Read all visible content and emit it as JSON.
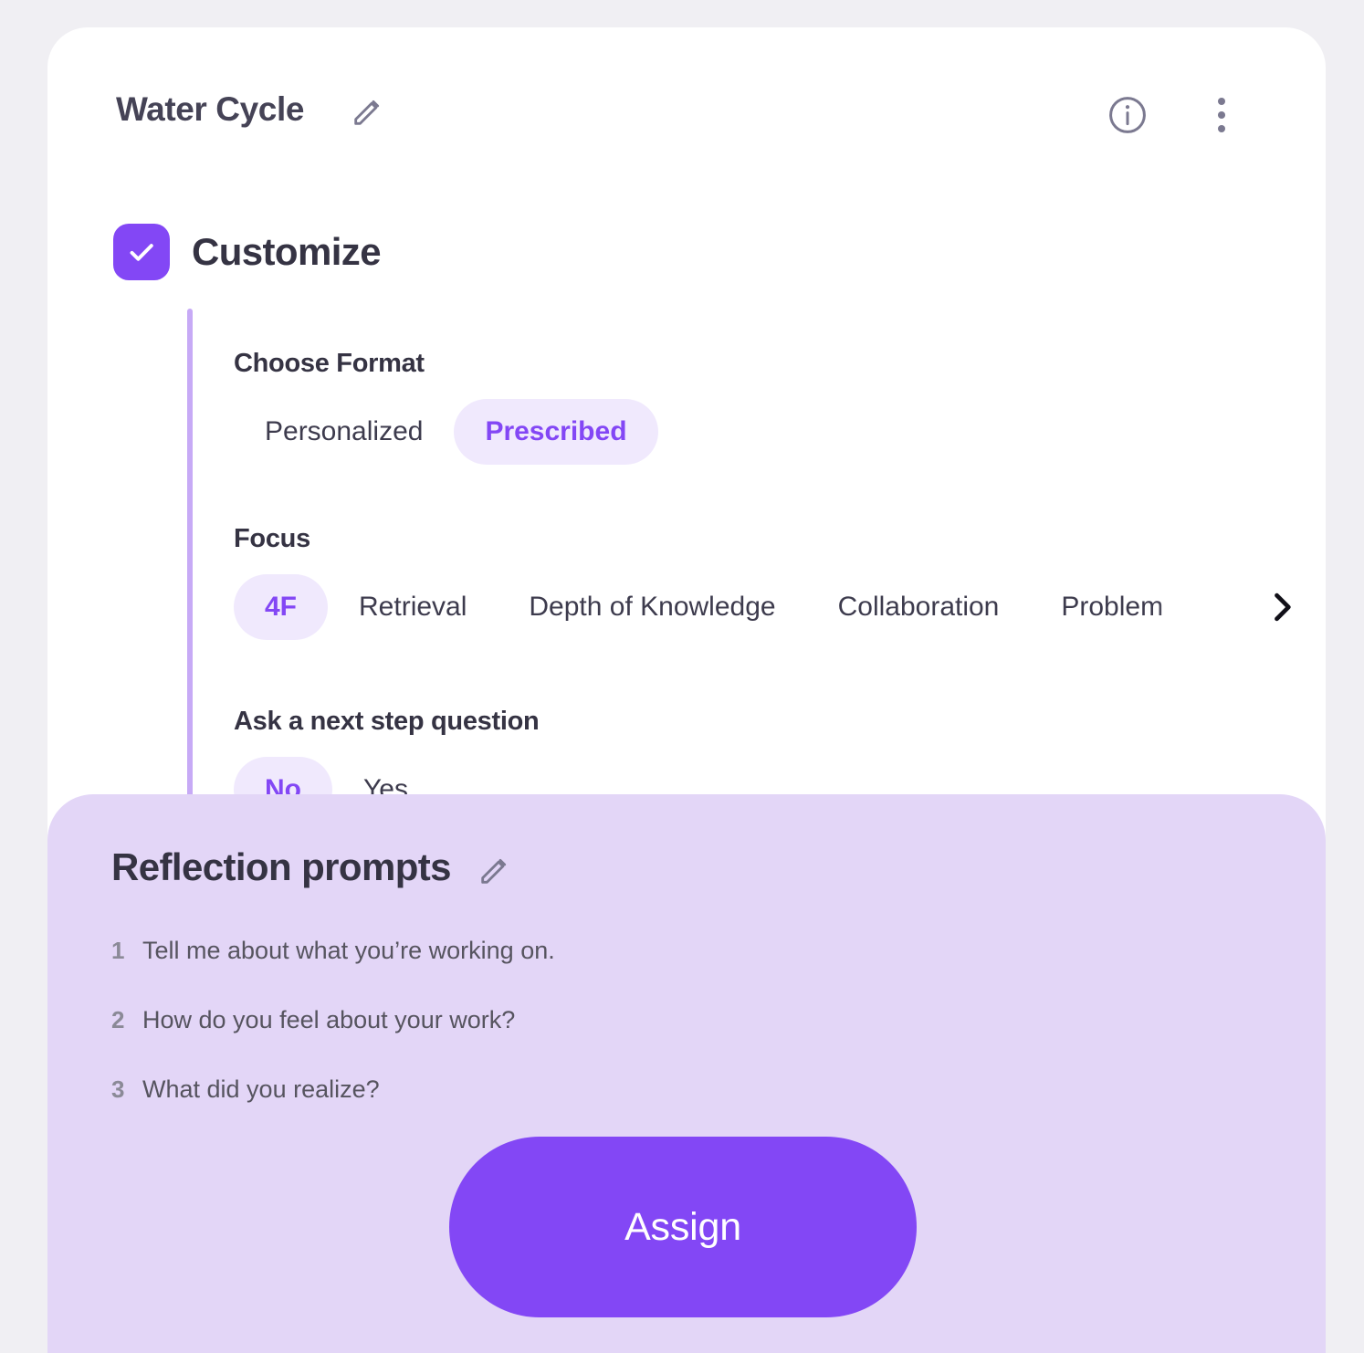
{
  "header": {
    "title": "Water Cycle",
    "edit_icon": "pencil-icon",
    "info_icon": "info-circle-icon",
    "menu_icon": "kebab-menu-icon"
  },
  "customize": {
    "label": "Customize",
    "checked": true,
    "check_icon": "check-icon"
  },
  "groups": [
    {
      "title": "Choose Format",
      "options": [
        {
          "label": "Personalized",
          "selected": false
        },
        {
          "label": "Prescribed",
          "selected": true
        }
      ]
    },
    {
      "title": "Focus",
      "scrollable": true,
      "next_icon": "chevron-right-icon",
      "options": [
        {
          "label": "4F",
          "selected": true
        },
        {
          "label": "Retrieval",
          "selected": false
        },
        {
          "label": "Depth of Knowledge",
          "selected": false
        },
        {
          "label": "Collaboration",
          "selected": false
        },
        {
          "label": "Problem",
          "selected": false
        }
      ]
    },
    {
      "title": "Ask a next step question",
      "options": [
        {
          "label": "No",
          "selected": true
        },
        {
          "label": "Yes",
          "selected": false
        }
      ]
    }
  ],
  "reflection": {
    "title": "Reflection prompts",
    "edit_icon": "pencil-icon",
    "prompts": [
      {
        "num": "1",
        "text": "Tell me about what you’re working on."
      },
      {
        "num": "2",
        "text": "How do you feel about your work?"
      },
      {
        "num": "3",
        "text": "What did you realize?"
      }
    ],
    "assign_label": "Assign"
  },
  "colors": {
    "accent": "#8347f5",
    "panel": "#e3d6f7",
    "pill_selected_bg": "#f0e9fd",
    "page_bg": "#f0eff3",
    "text_dark": "#353343",
    "text_muted": "#56545f"
  }
}
